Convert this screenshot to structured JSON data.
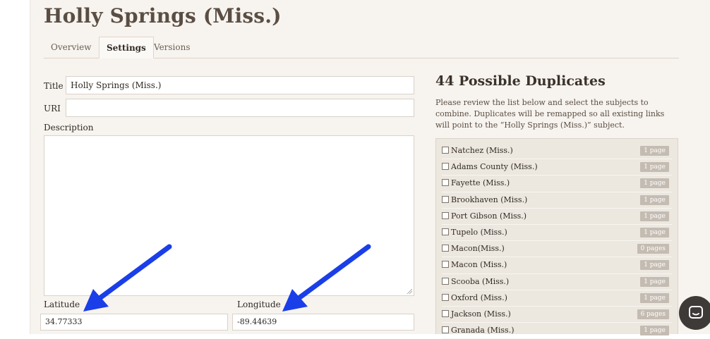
{
  "page": {
    "title": "Holly Springs (Miss.)"
  },
  "tabs": [
    {
      "label": "Overview",
      "active": false
    },
    {
      "label": "Settings",
      "active": true
    },
    {
      "label": "Versions",
      "active": false
    }
  ],
  "form": {
    "title_label": "Title",
    "title_value": "Holly Springs (Miss.)",
    "uri_label": "URI",
    "uri_value": "",
    "description_label": "Description",
    "description_value": "",
    "latitude_label": "Latitude",
    "latitude_value": "34.77333",
    "longitude_label": "Longitude",
    "longitude_value": "-89.44639"
  },
  "duplicates": {
    "heading": "44 Possible Duplicates",
    "description": "Please review the list below and select the subjects to combine. Duplicates will be remapped so all existing links will point to the “Holly Springs (Miss.)” subject.",
    "items": [
      {
        "label": "Natchez (Miss.)",
        "count": "1 page"
      },
      {
        "label": "Adams County (Miss.)",
        "count": "1 page"
      },
      {
        "label": "Fayette (Miss.)",
        "count": "1 page"
      },
      {
        "label": "Brookhaven (Miss.)",
        "count": "1 page"
      },
      {
        "label": "Port Gibson (Miss.)",
        "count": "1 page"
      },
      {
        "label": "Tupelo (Miss.)",
        "count": "1 page"
      },
      {
        "label": "Macon(Miss.)",
        "count": "0 pages"
      },
      {
        "label": "Macon (Miss.)",
        "count": "1 page"
      },
      {
        "label": "Scooba (Miss.)",
        "count": "1 page"
      },
      {
        "label": "Oxford (Miss.)",
        "count": "1 page"
      },
      {
        "label": "Jackson (Miss.)",
        "count": "6 pages"
      },
      {
        "label": "Granada (Miss.)",
        "count": "1 page"
      }
    ]
  },
  "annotations": {
    "arrow_color": "#1a3ee8"
  },
  "colors": {
    "badge": "#c4bcb2",
    "panel": "#f7f3ee",
    "chat": "#3d3a37"
  },
  "icons": {
    "chat": "chat-bubble-icon",
    "arrow": "arrow-annotation-icon"
  }
}
